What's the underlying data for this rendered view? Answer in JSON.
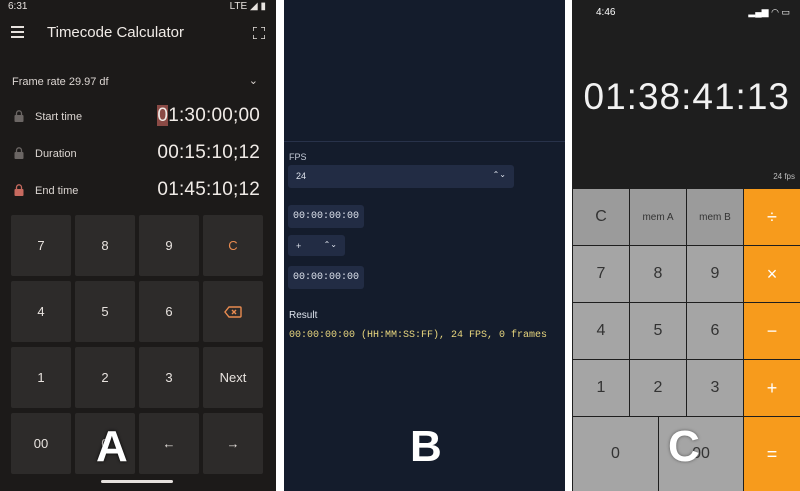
{
  "panel_a": {
    "status": {
      "time": "6:31",
      "network": "LTE"
    },
    "title": "Timecode Calculator",
    "frame_rate": "Frame rate 29.97 df",
    "rows": [
      {
        "label": "Start time",
        "value_first": "0",
        "value_rest": "1:30:00;00"
      },
      {
        "label": "Duration",
        "value": "00:15:10;12"
      },
      {
        "label": "End time",
        "value": "01:45:10;12"
      }
    ],
    "keys": [
      "7",
      "8",
      "9",
      "C",
      "4",
      "5",
      "6",
      "",
      "1",
      "2",
      "3",
      "Next",
      "00",
      "0",
      "←",
      "→"
    ],
    "letter": "A"
  },
  "panel_b": {
    "fps_label": "FPS",
    "fps_value": "24",
    "tc1": "00:00:00:00",
    "operator": "+",
    "tc2": "00:00:00:00",
    "result_label": "Result",
    "result": "00:00:00:00 (HH:MM:SS:FF), 24 FPS, 0 frames",
    "letter": "B"
  },
  "panel_c": {
    "time": "4:46",
    "display": "01:38:41:13",
    "fps": "24 fps",
    "keys": [
      "C",
      "mem A",
      "mem B",
      "÷",
      "7",
      "8",
      "9",
      "×",
      "4",
      "5",
      "6",
      "−",
      "1",
      "2",
      "3",
      "+",
      "0",
      "00",
      "="
    ],
    "letter": "C"
  }
}
